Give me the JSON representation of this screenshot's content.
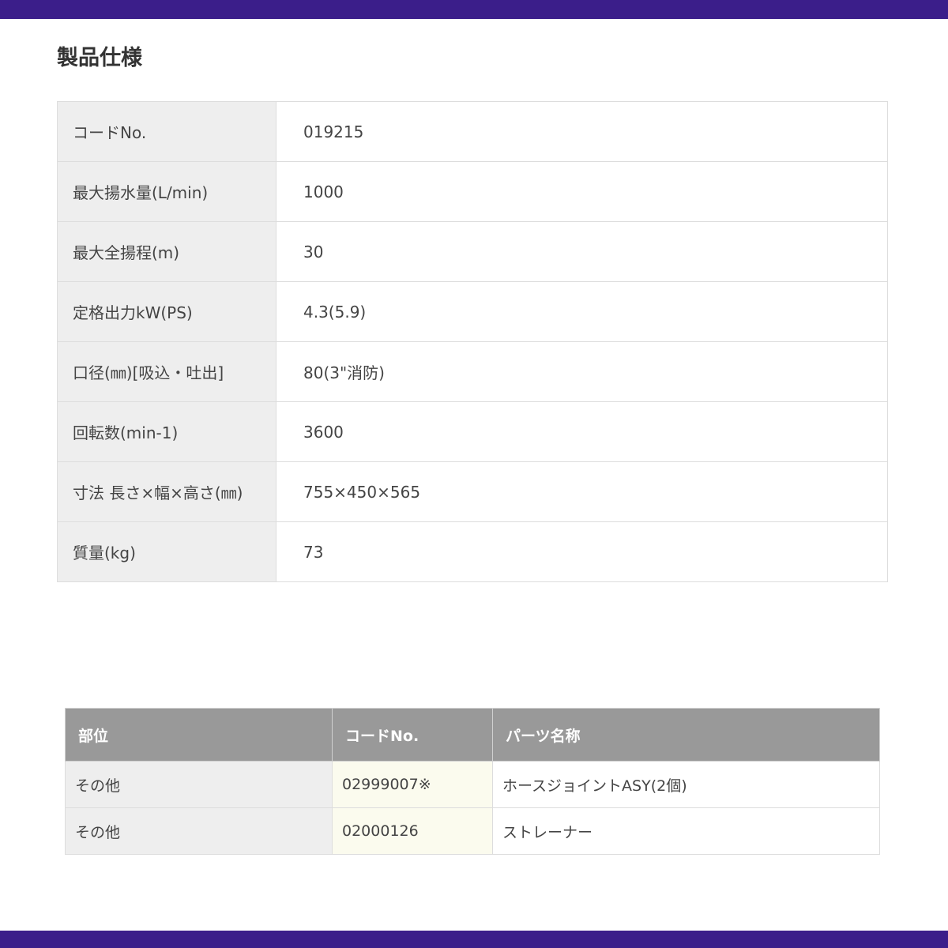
{
  "page_title": "製品仕様",
  "colors": {
    "brand_bar": "#3b1e8a",
    "label_cell_bg": "#eeeeee",
    "header_bg": "#999999",
    "code_cell_bg": "#fbfbee"
  },
  "spec": [
    {
      "label": "コードNo.",
      "value": "019215"
    },
    {
      "label": "最大揚水量(L/min)",
      "value": "1000"
    },
    {
      "label": "最大全揚程(m)",
      "value": "30"
    },
    {
      "label": "定格出力kW(PS)",
      "value": "4.3(5.9)"
    },
    {
      "label": "口径(㎜)[吸込・吐出]",
      "value": "80(3\"消防)"
    },
    {
      "label": "回転数(min-1)",
      "value": "3600"
    },
    {
      "label": "寸法 長さ×幅×高さ(㎜)",
      "value": "755×450×565"
    },
    {
      "label": "質量(kg)",
      "value": "73"
    }
  ],
  "parts": {
    "headers": [
      "部位",
      "コードNo.",
      "パーツ名称"
    ],
    "rows": [
      {
        "part": "その他",
        "code": "02999007※",
        "name": "ホースジョイントASY(2個)"
      },
      {
        "part": "その他",
        "code": "02000126",
        "name": "ストレーナー"
      }
    ]
  }
}
